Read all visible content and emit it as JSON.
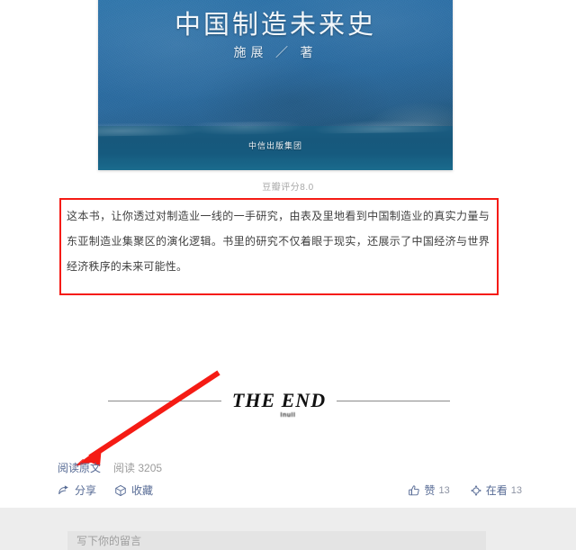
{
  "article": {
    "cover": {
      "title": "中国制造未来史",
      "author": "施展 ／ 著",
      "publisher": "中信出版集团",
      "base_color": "#2a6ea6",
      "band_color": "#17587c"
    },
    "rating": "豆瓣评分8.0",
    "highlight": {
      "text": "这本书，让你透过对制造业一线的一手研究，由表及里地看到中国制造业的真实力量与东亚制造业集聚区的演化逻辑。书里的研究不仅着眼于现实，还展示了中国经济与世界经济秩序的未来可能性。",
      "border_color": "#f51b14"
    },
    "end_divider": {
      "text": "THE END",
      "sub_text": "Inull"
    },
    "annotation": {
      "color": "#f51b14",
      "type": "arrow",
      "points_to": "阅读原文"
    }
  },
  "footer": {
    "read_origin_label": "阅读原文",
    "read_count_label": "阅读",
    "read_count_value": "3205",
    "link_color": "#576b95",
    "actions": [
      {
        "icon": "share-icon",
        "label": "分享"
      },
      {
        "icon": "favorite-icon",
        "label": "收藏"
      }
    ],
    "counters": [
      {
        "icon": "thumbs-up-icon",
        "label": "赞",
        "value": "13"
      },
      {
        "icon": "wow-icon",
        "label": "在看",
        "value": "13"
      }
    ]
  },
  "comment": {
    "placeholder": "写下你的留言"
  }
}
